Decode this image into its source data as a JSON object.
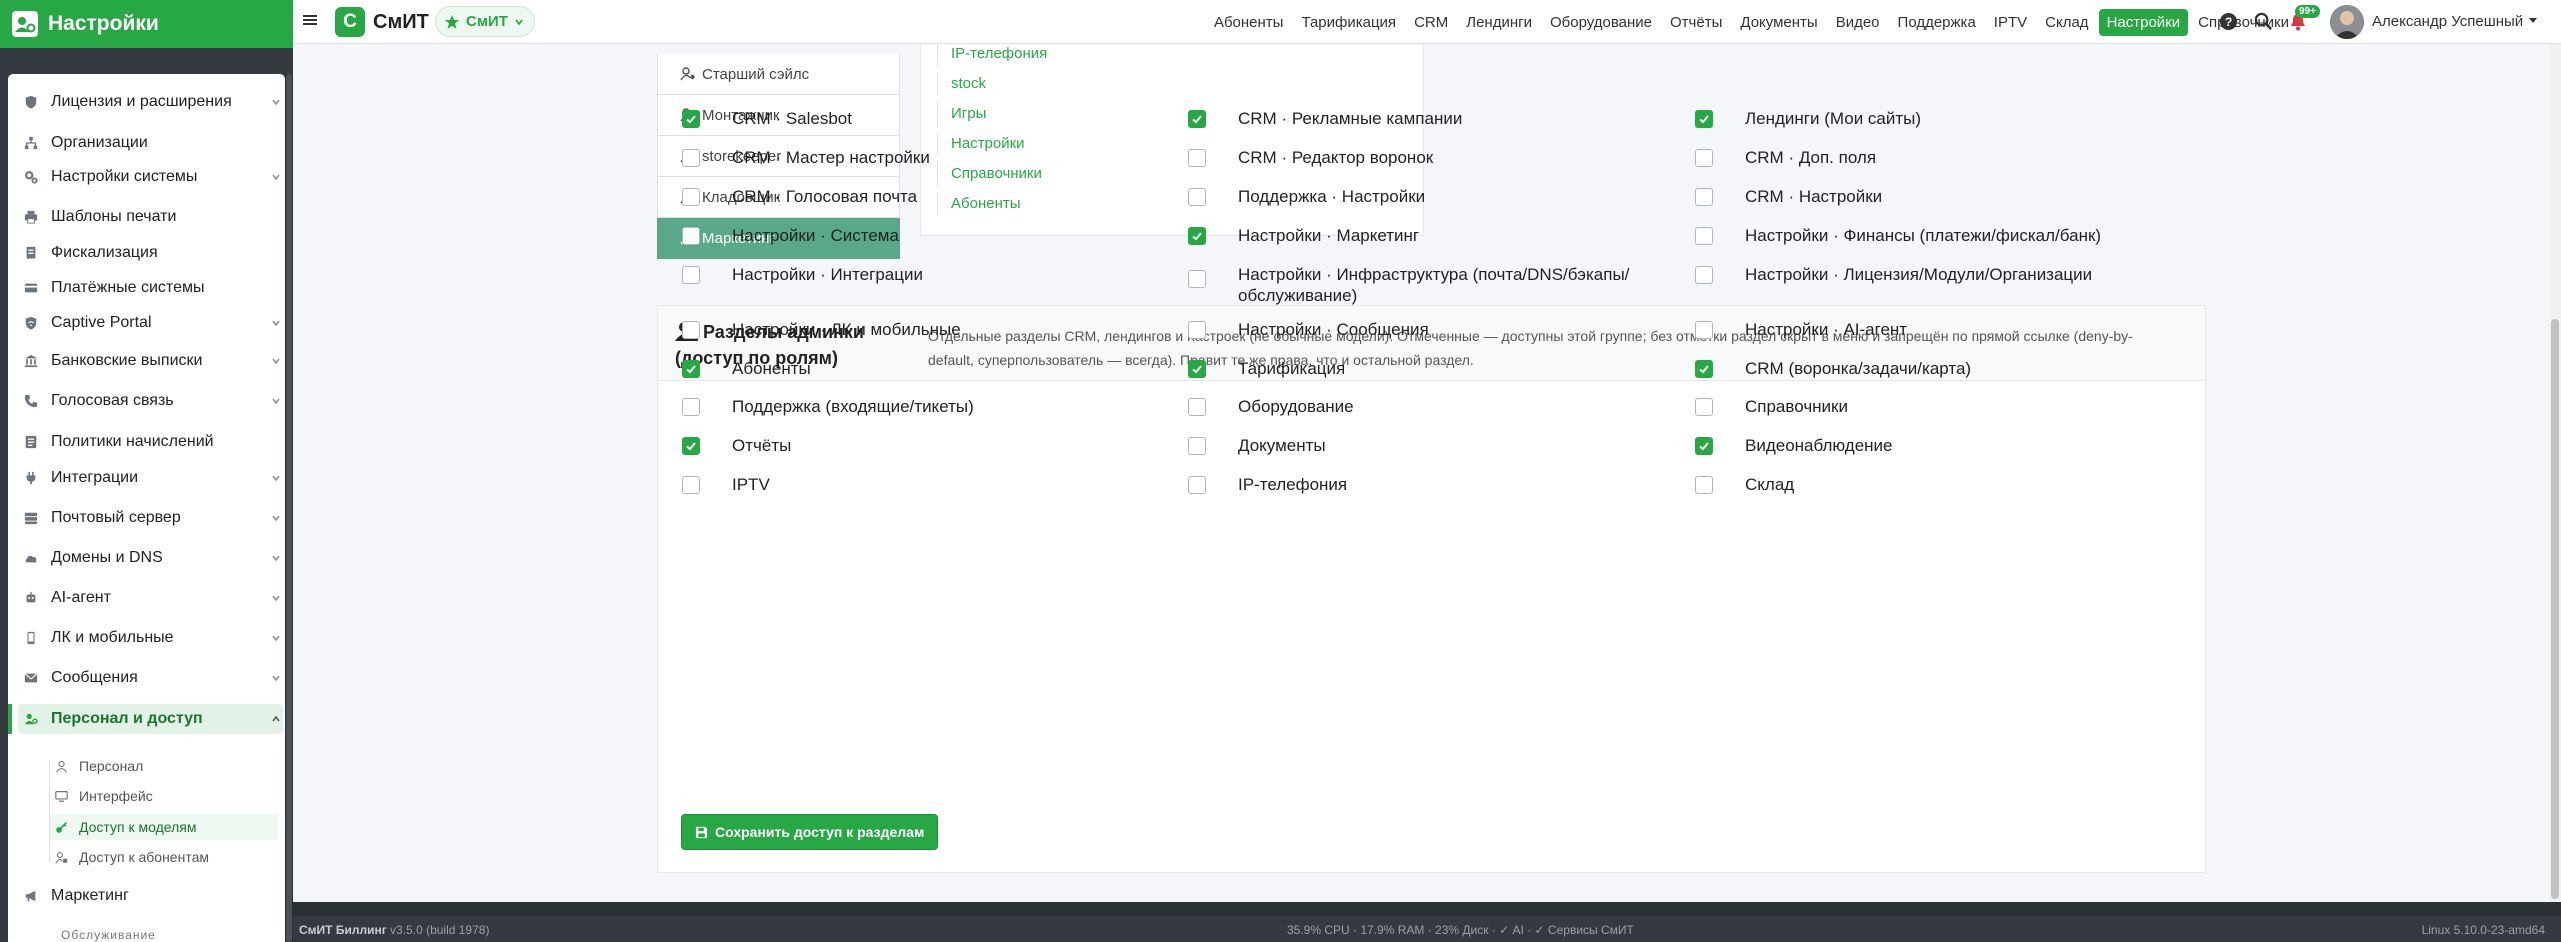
{
  "brand": {
    "title": "Настройки"
  },
  "sidebar": {
    "items": [
      {
        "label": "Лицензия и расширения",
        "icon": "shield-icon",
        "expandable": true
      },
      {
        "label": "Организации",
        "icon": "sitemap-icon",
        "expandable": false
      },
      {
        "label": "Настройки системы",
        "icon": "gears-icon",
        "expandable": true
      },
      {
        "label": "Шаблоны печати",
        "icon": "print-icon",
        "expandable": false
      },
      {
        "label": "Фискализация",
        "icon": "receipt-icon",
        "expandable": false
      },
      {
        "label": "Платёжные системы",
        "icon": "credit-card-icon",
        "expandable": false
      },
      {
        "label": "Captive Portal",
        "icon": "wifi-shield-icon",
        "expandable": true
      },
      {
        "label": "Банковские выписки",
        "icon": "bank-icon",
        "expandable": true
      },
      {
        "label": "Голосовая связь",
        "icon": "phone-icon",
        "expandable": true
      },
      {
        "label": "Политики начислений",
        "icon": "policy-icon",
        "expandable": false
      },
      {
        "label": "Интеграции",
        "icon": "plug-icon",
        "expandable": true
      },
      {
        "label": "Почтовый сервер",
        "icon": "mail-server-icon",
        "expandable": true
      },
      {
        "label": "Домены и DNS",
        "icon": "cloud-icon",
        "expandable": true
      },
      {
        "label": "AI-агент",
        "icon": "robot-icon",
        "expandable": true
      },
      {
        "label": "ЛК и мобильные",
        "icon": "mobile-icon",
        "expandable": true
      },
      {
        "label": "Сообщения",
        "icon": "envelope-icon",
        "expandable": true
      },
      {
        "label": "Персонал и доступ",
        "icon": "users-cog-icon",
        "expandable": true,
        "active": true
      }
    ],
    "sub_items": [
      {
        "label": "Персонал",
        "icon": "user-icon"
      },
      {
        "label": "Интерфейс",
        "icon": "desktop-icon"
      },
      {
        "label": "Доступ к моделям",
        "icon": "key-icon",
        "current": true
      },
      {
        "label": "Доступ к абонентам",
        "icon": "user-lock-icon"
      }
    ],
    "marketing": {
      "label": "Маркетинг",
      "icon": "bullhorn-icon"
    },
    "section_label": "Обслуживание"
  },
  "topbar": {
    "app_logo": "С",
    "app_name": "СмИТ",
    "app_pill": "СмИТ",
    "nav": [
      "Абоненты",
      "Тарификация",
      "CRM",
      "Лендинги",
      "Оборудование",
      "Отчёты",
      "Документы",
      "Видео",
      "Поддержка",
      "IPTV",
      "Склад",
      "Настройки",
      "Справочники"
    ],
    "active_nav": "Настройки",
    "notifications_badge": "99+",
    "user_name": "Александр Успешный"
  },
  "roles": {
    "items": [
      "Старший сэйлс",
      "Монтажник",
      "storekeeper",
      "Кладовщик",
      "Маркетинг"
    ],
    "active": "Маркетинг"
  },
  "permissions": {
    "links": [
      "IP-телефония",
      "stock",
      "Игры",
      "Настройки",
      "Справочники",
      "Абоненты"
    ]
  },
  "sections": {
    "title": "Разделы админки (доступ по ролям)",
    "description": "Отдельные разделы CRM, лендингов и настроек (не обычные модели). Отмеченные — доступны этой группе; без отметки раздел скрыт в меню и запрещён по прямой ссылке (deny-by-default, суперпользователь — всегда). Правит те же права, что и остальной раздел.",
    "columns": [
      [
        {
          "label": "CRM · Salesbot",
          "checked": true
        },
        {
          "label": "CRM · Мастер настройки",
          "checked": false
        },
        {
          "label": "CRM · Голосовая почта",
          "checked": false
        },
        {
          "label": "Настройки · Система",
          "checked": false
        },
        {
          "label": "Настройки · Интеграции",
          "checked": false
        },
        {
          "label": "Настройки · ЛК и мобильные",
          "checked": false
        },
        {
          "label": "Абоненты",
          "checked": true
        },
        {
          "label": "Поддержка (входящие/тикеты)",
          "checked": false
        },
        {
          "label": "Отчёты",
          "checked": true
        },
        {
          "label": "IPTV",
          "checked": false
        }
      ],
      [
        {
          "label": "CRM · Рекламные кампании",
          "checked": true
        },
        {
          "label": "CRM · Редактор воронок",
          "checked": false
        },
        {
          "label": "Поддержка · Настройки",
          "checked": false
        },
        {
          "label": "Настройки · Маркетинг",
          "checked": true
        },
        {
          "label": "Настройки · Инфраструктура (почта/DNS/бэкапы/обслуживание)",
          "checked": false
        },
        {
          "label": "Настройки · Сообщения",
          "checked": false
        },
        {
          "label": "Тарификация",
          "checked": true
        },
        {
          "label": "Оборудование",
          "checked": false
        },
        {
          "label": "Документы",
          "checked": false
        },
        {
          "label": "IP-телефония",
          "checked": false
        }
      ],
      [
        {
          "label": "Лендинги (Мои сайты)",
          "checked": true
        },
        {
          "label": "CRM · Доп. поля",
          "checked": false
        },
        {
          "label": "CRM · Настройки",
          "checked": false
        },
        {
          "label": "Настройки · Финансы (платежи/фискал/банк)",
          "checked": false
        },
        {
          "label": "Настройки · Лицензия/Модули/Организации",
          "checked": false
        },
        {
          "label": "Настройки · AI-агент",
          "checked": false
        },
        {
          "label": "CRM (воронка/задачи/карта)",
          "checked": true
        },
        {
          "label": "Справочники",
          "checked": false
        },
        {
          "label": "Видеонаблюдение",
          "checked": true
        },
        {
          "label": "Склад",
          "checked": false
        }
      ]
    ],
    "save_label": "Сохранить доступ к разделам"
  },
  "footer": {
    "product": "СмИТ Биллинг",
    "version": "v3.5.0 (build 1978)",
    "stats": "35.9% CPU · 17.9% RAM · 23% Диск · ✓ AI · ✓ Сервисы СмИТ",
    "os": "Linux 5.10.0-23-amd64"
  },
  "colors": {
    "accent": "#28a745",
    "sidebar_dark": "#343a40",
    "role_active": "#5aa88a"
  }
}
